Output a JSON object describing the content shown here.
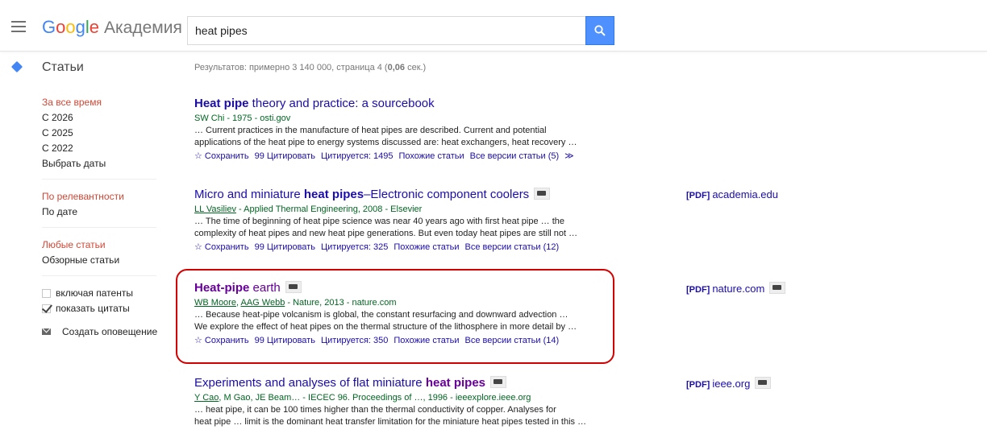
{
  "header": {
    "logo_letters": [
      "G",
      "o",
      "o",
      "g",
      "l",
      "e"
    ],
    "logo_suffix": "Академия",
    "search_value": "heat pipes"
  },
  "subheader": {
    "section": "Статьи",
    "stats_prefix": "Результатов: примерно 3 140 000, страница 4 (",
    "stats_time": "0,06",
    "stats_suffix": " сек.)"
  },
  "sidebar": {
    "time": [
      "За все время",
      "С 2026",
      "С 2025",
      "С 2022",
      "Выбрать даты"
    ],
    "sort": [
      "По релевантности",
      "По дате"
    ],
    "type": [
      "Любые статьи",
      "Обзорные статьи"
    ],
    "include_patents": "включая патенты",
    "show_citations": "показать цитаты",
    "create_alert": "Создать оповещение"
  },
  "results": [
    {
      "title_bold": "Heat pipe",
      "title_rest": " theory and practice: a sourcebook",
      "authors": "SW Chi - 1975 - osti.gov",
      "snippet1": "… Current practices in the manufacture of heat pipes are described. Current and potential",
      "snippet2": "applications of the heat pipe to energy systems discussed are: heat exchangers, heat recovery …",
      "save": "☆ Сохранить",
      "cite": "99 Цитировать",
      "cited_by": "Цитируется: 1495",
      "related": "Похожие статьи",
      "versions": "Все версии статьи (5)",
      "more": "≫"
    },
    {
      "title_start": "Micro and miniature ",
      "title_bold": "heat pipes",
      "title_rest": "–Electronic component coolers",
      "author1": "LL Vasiliev",
      "author_rest": " - Applied Thermal Engineering, 2008 - Elsevier",
      "snippet1": "… The time of beginning of heat pipe science was near 40 years ago with first heat pipe … the",
      "snippet2": "complexity of heat pipes and new heat pipe generations. But even today heat pipes are still not …",
      "save": "☆ Сохранить",
      "cite": "99 Цитировать",
      "cited_by": "Цитируется: 325",
      "related": "Похожие статьи",
      "versions": "Все версии статьи (12)",
      "pdf": "[PDF]",
      "pdf_source": "academia.edu"
    },
    {
      "title_bold": "Heat-pipe",
      "title_rest": " earth",
      "author1": "WB Moore",
      "author2": "AAG Webb",
      "author_rest": " - Nature, 2013 - nature.com",
      "snippet1": "… Because heat-pipe volcanism is global, the constant resurfacing and downward advection …",
      "snippet2": "We explore the effect of heat pipes on the thermal structure of the lithosphere in more detail by …",
      "save": "☆ Сохранить",
      "cite": "99 Цитировать",
      "cited_by": "Цитируется: 350",
      "related": "Похожие статьи",
      "versions": "Все версии статьи (14)",
      "pdf": "[PDF]",
      "pdf_source": "nature.com"
    },
    {
      "title_start": "Experiments and analyses of flat miniature ",
      "title_bold": "heat pipes",
      "author1": "Y Cao",
      "author_rest": ", M Gao, JE Beam… - IECEC 96. Proceedings of …, 1996 - ieeexplore.ieee.org",
      "snippet1": "… heat pipe, it can be 100 times higher than the thermal conductivity of copper. Analyses for",
      "snippet2": "heat pipe … limit is the dominant heat transfer limitation for the miniature heat pipes tested in this …",
      "pdf": "[PDF]",
      "pdf_source": "ieee.org"
    }
  ],
  "colors": {
    "link": "#1a0dab",
    "visited": "#660099",
    "green": "#006621",
    "selected": "#d14836",
    "search_button": "#4d90fe",
    "highlight": "#d40000"
  }
}
